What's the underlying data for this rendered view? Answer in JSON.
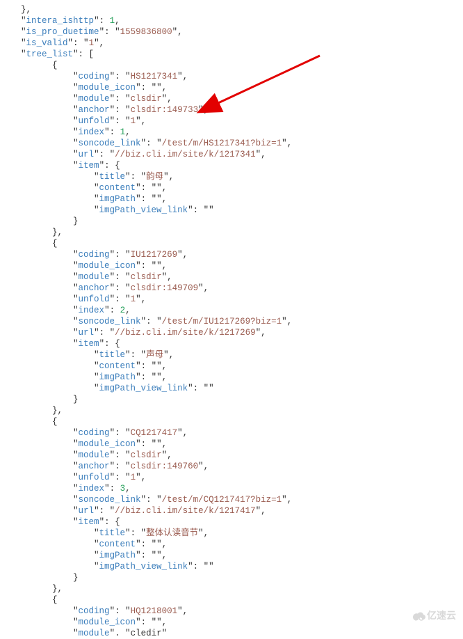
{
  "code": {
    "line1_close": "},",
    "intera_ishttp_key": "intera_ishttp",
    "intera_ishttp_val": "1",
    "is_pro_duetime_key": "is_pro_duetime",
    "is_pro_duetime_val": "1559836800",
    "is_valid_key": "is_valid",
    "is_valid_val": "1",
    "tree_list_key": "tree_list",
    "items": [
      {
        "coding_key": "coding",
        "coding_val": "HS1217341",
        "module_icon_key": "module_icon",
        "module_icon_val": "",
        "module_key": "module",
        "module_val": "clsdir",
        "anchor_key": "anchor",
        "anchor_val": "clsdir:149733",
        "unfold_key": "unfold",
        "unfold_val": "1",
        "index_key": "index",
        "index_val": "1",
        "soncode_link_key": "soncode_link",
        "soncode_link_val": "/test/m/HS1217341?biz=1",
        "url_key": "url",
        "url_val": "//biz.cli.im/site/k/1217341",
        "item_key": "item",
        "title_key": "title",
        "title_val": "韵母",
        "content_key": "content",
        "content_val": "",
        "imgPath_key": "imgPath",
        "imgPath_val": "",
        "imgPath_view_link_key": "imgPath_view_link",
        "imgPath_view_link_val": ""
      },
      {
        "coding_key": "coding",
        "coding_val": "IU1217269",
        "module_icon_key": "module_icon",
        "module_icon_val": "",
        "module_key": "module",
        "module_val": "clsdir",
        "anchor_key": "anchor",
        "anchor_val": "clsdir:149709",
        "unfold_key": "unfold",
        "unfold_val": "1",
        "index_key": "index",
        "index_val": "2",
        "soncode_link_key": "soncode_link",
        "soncode_link_val": "/test/m/IU1217269?biz=1",
        "url_key": "url",
        "url_val": "//biz.cli.im/site/k/1217269",
        "item_key": "item",
        "title_key": "title",
        "title_val": "声母",
        "content_key": "content",
        "content_val": "",
        "imgPath_key": "imgPath",
        "imgPath_val": "",
        "imgPath_view_link_key": "imgPath_view_link",
        "imgPath_view_link_val": ""
      },
      {
        "coding_key": "coding",
        "coding_val": "CQ1217417",
        "module_icon_key": "module_icon",
        "module_icon_val": "",
        "module_key": "module",
        "module_val": "clsdir",
        "anchor_key": "anchor",
        "anchor_val": "clsdir:149760",
        "unfold_key": "unfold",
        "unfold_val": "1",
        "index_key": "index",
        "index_val": "3",
        "soncode_link_key": "soncode_link",
        "soncode_link_val": "/test/m/CQ1217417?biz=1",
        "url_key": "url",
        "url_val": "//biz.cli.im/site/k/1217417",
        "item_key": "item",
        "title_key": "title",
        "title_val": "整体认读音节",
        "content_key": "content",
        "content_val": "",
        "imgPath_key": "imgPath",
        "imgPath_val": "",
        "imgPath_view_link_key": "imgPath_view_link",
        "imgPath_view_link_val": ""
      },
      {
        "coding_key": "coding",
        "coding_val": "HQ1218001",
        "module_icon_key": "module_icon",
        "module_icon_val": "",
        "module_key_partial": "module"
      }
    ]
  },
  "watermark": {
    "text": "亿速云"
  }
}
